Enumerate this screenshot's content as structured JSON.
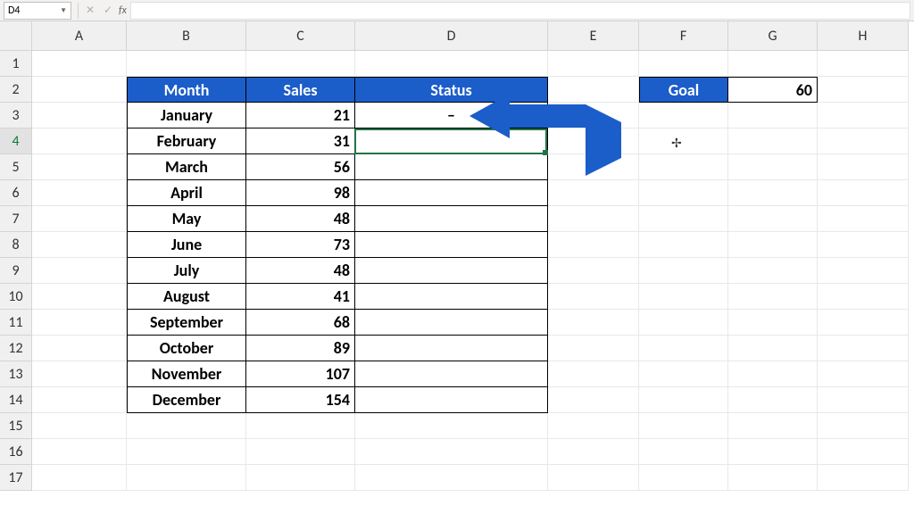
{
  "namebox": "D4",
  "fx_label": "fx",
  "columns": [
    "A",
    "B",
    "C",
    "D",
    "E",
    "F",
    "G",
    "H"
  ],
  "rows": [
    "1",
    "2",
    "3",
    "4",
    "5",
    "6",
    "7",
    "8",
    "9",
    "10",
    "11",
    "12",
    "13",
    "14",
    "15",
    "16",
    "17"
  ],
  "headers": {
    "month": "Month",
    "sales": "Sales",
    "status": "Status"
  },
  "goal": {
    "label": "Goal",
    "value": "60"
  },
  "status_d3": "–",
  "data": [
    {
      "month": "January",
      "sales": "21"
    },
    {
      "month": "February",
      "sales": "31"
    },
    {
      "month": "March",
      "sales": "56"
    },
    {
      "month": "April",
      "sales": "98"
    },
    {
      "month": "May",
      "sales": "48"
    },
    {
      "month": "June",
      "sales": "73"
    },
    {
      "month": "July",
      "sales": "48"
    },
    {
      "month": "August",
      "sales": "41"
    },
    {
      "month": "September",
      "sales": "68"
    },
    {
      "month": "October",
      "sales": "89"
    },
    {
      "month": "November",
      "sales": "107"
    },
    {
      "month": "December",
      "sales": "154"
    }
  ],
  "selected_cell": "D4"
}
